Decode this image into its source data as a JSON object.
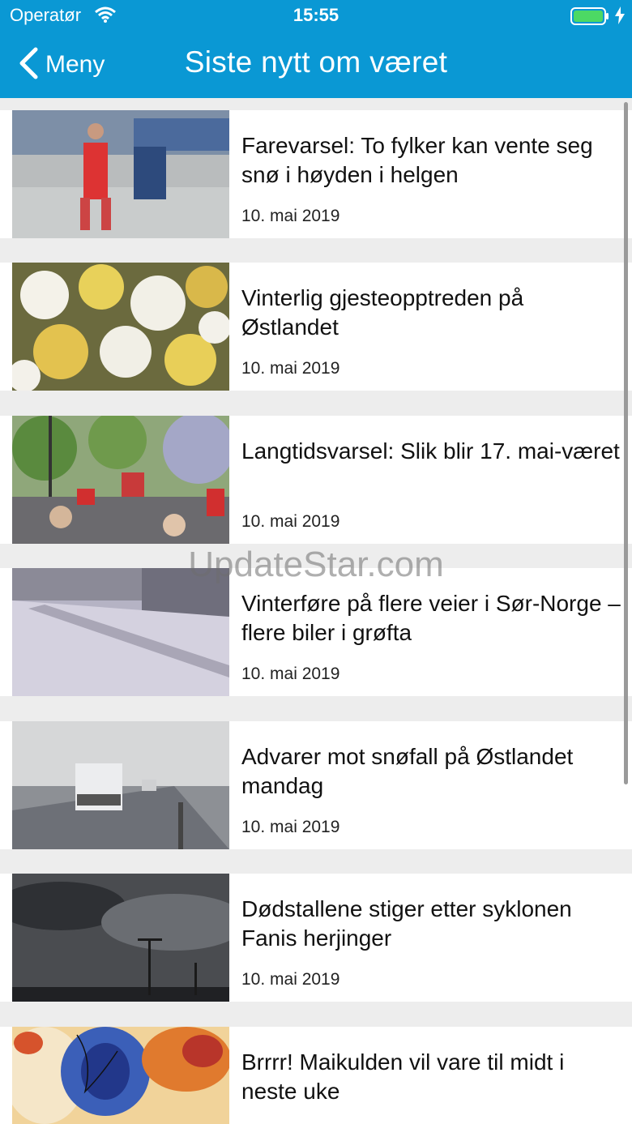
{
  "status": {
    "carrier": "Operatør",
    "time": "15:55"
  },
  "nav": {
    "back_label": "Meny",
    "title": "Siste nytt om været"
  },
  "articles": [
    {
      "headline": "Farevarsel: To fylker kan vente seg snø i høyden i helgen",
      "date": "10. mai 2019"
    },
    {
      "headline": "Vinterlig gjesteopptreden på Østlandet",
      "date": "10. mai 2019"
    },
    {
      "headline": "Langtidsvarsel: Slik blir 17. mai-været",
      "date": "10. mai 2019"
    },
    {
      "headline": "Vinterføre på flere veier i Sør-Norge – flere biler i grøfta",
      "date": "10. mai 2019"
    },
    {
      "headline": "Advarer mot snøfall på Østlandet mandag",
      "date": "10. mai 2019"
    },
    {
      "headline": "Dødstallene stiger etter syklonen Fanis herjinger",
      "date": "10. mai 2019"
    },
    {
      "headline": "Brrrr! Maikulden vil vare til midt i neste uke",
      "date": ""
    }
  ],
  "watermark": "UpdateStar.com",
  "colors": {
    "header": "#0a98d4",
    "battery": "#4cd964"
  }
}
